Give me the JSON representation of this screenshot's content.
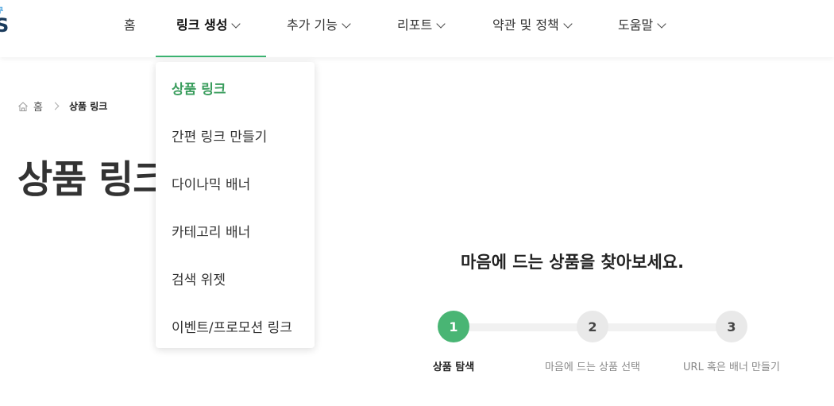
{
  "logo": {
    "small": "쿠",
    "big": "S"
  },
  "nav": [
    {
      "label": "홈"
    },
    {
      "label": "링크 생성"
    },
    {
      "label": "추가 기능"
    },
    {
      "label": "리포트"
    },
    {
      "label": "약관 및 정책"
    },
    {
      "label": "도움말"
    }
  ],
  "breadcrumb": {
    "home": "홈",
    "current": "상품 링크"
  },
  "page_title": "상품 링크",
  "dropdown": [
    {
      "label": "상품 링크"
    },
    {
      "label": "간편 링크 만들기"
    },
    {
      "label": "다이나믹 배너"
    },
    {
      "label": "카테고리 배너"
    },
    {
      "label": "검색 위젯"
    },
    {
      "label": "이벤트/프로모션 링크"
    }
  ],
  "steps": {
    "headline": "마음에 드는 상품을 찾아보세요.",
    "items": [
      {
        "num": "1",
        "label": "상품 탐색"
      },
      {
        "num": "2",
        "label": "마음에 드는 상품 선택"
      },
      {
        "num": "3",
        "label": "URL 혹은 배너 만들기"
      }
    ]
  },
  "colors": {
    "accent": "#3cb371",
    "step_active": "#49b574",
    "step_inactive": "#e9e9e9"
  }
}
